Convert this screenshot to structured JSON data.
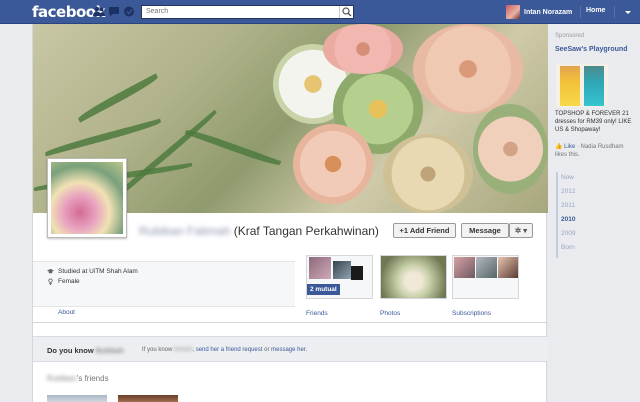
{
  "topbar": {
    "logo": "facebook",
    "search_placeholder": "Search",
    "user_name": "Intan Norazam",
    "home_label": "Home"
  },
  "profile": {
    "name_blurred": "Rubiban Fatimah",
    "name_suffix": " (Kraf Tangan Perkahwinan)",
    "add_friend_label": "+1 Add Friend",
    "message_label": "Message",
    "settings_label": "✲ ▾",
    "studied": "Studied at UiTM Shah Alam",
    "gender": "Female",
    "about_label": "About",
    "tabs": [
      {
        "label": "Friends",
        "badge": "2 mutual"
      },
      {
        "label": "Photos"
      },
      {
        "label": "Subscriptions"
      }
    ]
  },
  "do_you_know": {
    "prefix": "Do you know",
    "blurred_name": "Bubbah",
    "text_a": "If you know",
    "blurred_pronoun": "hmmm",
    "text_b": ", ",
    "link_a": "send her a friend request",
    "text_c": " or ",
    "link_b": "message her",
    "text_d": "."
  },
  "friends": {
    "blurred_owner": "Rubiban",
    "suffix": "'s friends"
  },
  "sidebar": {
    "sponsored": "Sponsored",
    "ad_title": "SeeSaw's Playground",
    "ad_text": "TOPSHOP & FOREVER 21 dresses for RM39 only! LIKE US & Shopaway!",
    "like_label": "Like",
    "like_text": " · Nadia Rusdham likes this.",
    "years": [
      "Now",
      "2012",
      "2011",
      "2010",
      "2009",
      "Born"
    ],
    "active_year": "2010"
  },
  "colors": {
    "brand": "#3b5998",
    "page_bg": "#e9ebee"
  }
}
